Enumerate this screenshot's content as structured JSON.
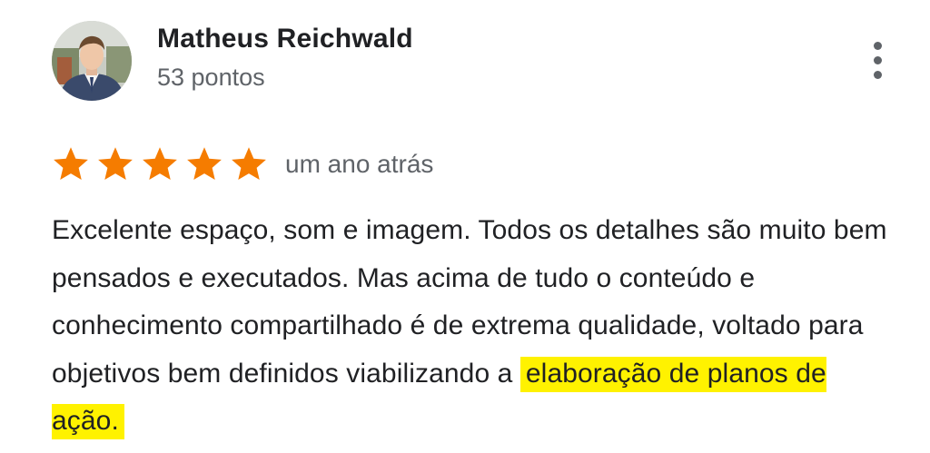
{
  "review": {
    "author": {
      "name": "Matheus Reichwald",
      "points": "53 pontos"
    },
    "rating": 5,
    "date": "um ano atrás",
    "text_plain": "Excelente espaço, som e imagem. Todos os detalhes são muito bem pensados e executados. Mas acima de tudo o conteúdo e conhecimento compartilhado é de extrema qualidade, voltado para objetivos bem definidos viabilizando a ",
    "text_highlight": "elaboração de planos de ação."
  },
  "icons": {
    "star": "star-icon",
    "more": "more-vert-icon"
  },
  "colors": {
    "star": "#f57c00",
    "highlight": "#fff200",
    "secondary_text": "#5f6368"
  }
}
